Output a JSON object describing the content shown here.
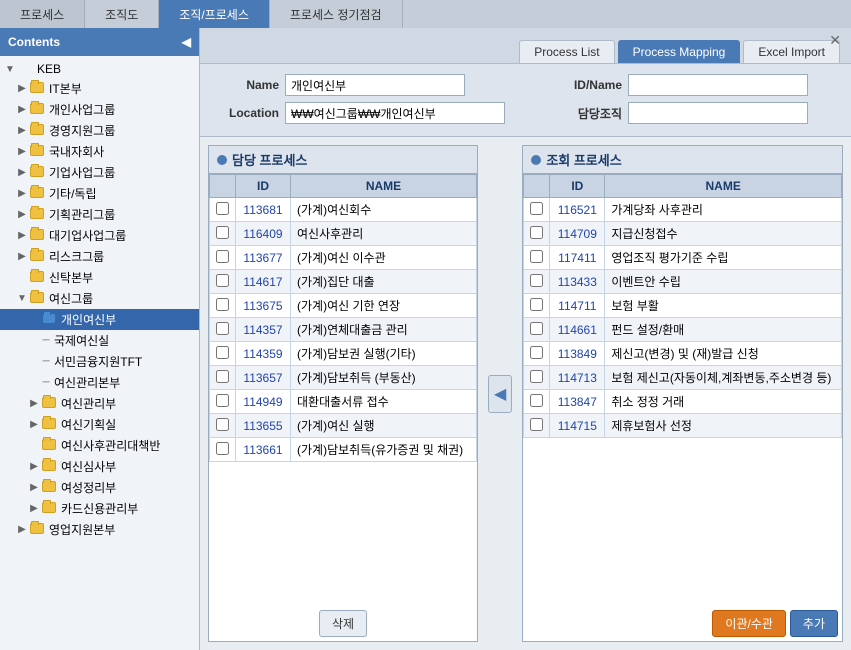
{
  "topNav": {
    "tabs": [
      {
        "id": "process",
        "label": "프로세스",
        "active": false
      },
      {
        "id": "orgchart",
        "label": "조직도",
        "active": false
      },
      {
        "id": "org-process",
        "label": "조직/프로세스",
        "active": true
      },
      {
        "id": "process-check",
        "label": "프로세스 정기점검",
        "active": false
      }
    ]
  },
  "subTabs": {
    "tabs": [
      {
        "id": "process-list",
        "label": "Process List",
        "active": false
      },
      {
        "id": "process-mapping",
        "label": "Process Mapping",
        "active": true
      },
      {
        "id": "excel-import",
        "label": "Excel Import",
        "active": false
      }
    ]
  },
  "sidebar": {
    "title": "Contents",
    "collapse_label": "◀",
    "tree": [
      {
        "id": "keb",
        "label": "KEB",
        "level": 0,
        "toggle": "▼",
        "type": "root"
      },
      {
        "id": "it",
        "label": "IT본부",
        "level": 1,
        "toggle": "▶",
        "type": "folder"
      },
      {
        "id": "personal-biz",
        "label": "개인사업그룹",
        "level": 1,
        "toggle": "▶",
        "type": "folder"
      },
      {
        "id": "mgmt-support",
        "label": "경영지원그룹",
        "level": 1,
        "toggle": "▶",
        "type": "folder"
      },
      {
        "id": "domestic-sub",
        "label": "국내자회사",
        "level": 1,
        "toggle": "▶",
        "type": "folder"
      },
      {
        "id": "corp-biz",
        "label": "기업사업그룹",
        "level": 1,
        "toggle": "▶",
        "type": "folder"
      },
      {
        "id": "other-indep",
        "label": "기타/독립",
        "level": 1,
        "toggle": "▶",
        "type": "folder"
      },
      {
        "id": "planning-mgmt",
        "label": "기획관리그룹",
        "level": 1,
        "toggle": "▶",
        "type": "folder"
      },
      {
        "id": "large-corp",
        "label": "대기업사업그룹",
        "level": 1,
        "toggle": "▶",
        "type": "folder"
      },
      {
        "id": "risk",
        "label": "리스크그룹",
        "level": 1,
        "toggle": "▶",
        "type": "folder"
      },
      {
        "id": "new-trust",
        "label": "신탁본부",
        "level": 1,
        "toggle": "",
        "type": "folder"
      },
      {
        "id": "women-credit",
        "label": "여신그룹",
        "level": 1,
        "toggle": "▼",
        "type": "folder"
      },
      {
        "id": "personal-credit",
        "label": "개인여신부",
        "level": 2,
        "toggle": "",
        "type": "folder",
        "selected": true
      },
      {
        "id": "intl-credit",
        "label": "국제여신실",
        "level": 3,
        "toggle": "",
        "type": "line"
      },
      {
        "id": "citizen-finance",
        "label": "서민금융지원TFT",
        "level": 3,
        "toggle": "",
        "type": "line"
      },
      {
        "id": "credit-mgmt",
        "label": "여신관리본부",
        "level": 3,
        "toggle": "",
        "type": "line"
      },
      {
        "id": "credit-mgmt-dept",
        "label": "여신관리부",
        "level": 2,
        "toggle": "▶",
        "type": "folder"
      },
      {
        "id": "credit-planning",
        "label": "여신기획실",
        "level": 2,
        "toggle": "▶",
        "type": "folder"
      },
      {
        "id": "credit-review",
        "label": "여신심사부",
        "level": 2,
        "toggle": "▶",
        "type": "folder"
      },
      {
        "id": "credit-mgmt2",
        "label": "여신사후관리대책반",
        "level": 2,
        "toggle": "",
        "type": "folder"
      },
      {
        "id": "credit-exam",
        "label": "여신심사부",
        "level": 2,
        "toggle": "▶",
        "type": "folder"
      },
      {
        "id": "credit-admin",
        "label": "여성정리부",
        "level": 2,
        "toggle": "▶",
        "type": "folder"
      },
      {
        "id": "card-credit",
        "label": "카드신용관리부",
        "level": 2,
        "toggle": "▶",
        "type": "folder"
      },
      {
        "id": "biz-support",
        "label": "영업지원본부",
        "level": 1,
        "toggle": "▶",
        "type": "folder"
      }
    ]
  },
  "form": {
    "name_label": "Name",
    "name_value": "개인여신부",
    "location_label": "Location",
    "location_value": "₩₩여신그룹₩₩개인여신부",
    "id_name_label": "ID/Name",
    "id_name_value": "",
    "resp_org_label": "담당조직",
    "resp_org_value": ""
  },
  "leftPanel": {
    "title": "담당 프로세스",
    "columns": [
      "",
      "ID",
      "NAME"
    ],
    "rows": [
      {
        "id": "113681",
        "name": "(가계)여신회수"
      },
      {
        "id": "116409",
        "name": "여신사후관리"
      },
      {
        "id": "113677",
        "name": "(가계)여신 이수관"
      },
      {
        "id": "114617",
        "name": "(가계)집단 대출"
      },
      {
        "id": "113675",
        "name": "(가계)여신 기한 연장"
      },
      {
        "id": "114357",
        "name": "(가계)연체대출금 관리"
      },
      {
        "id": "114359",
        "name": "(가계)담보권 실행(기타)"
      },
      {
        "id": "113657",
        "name": "(가계)담보취득 (부동산)"
      },
      {
        "id": "114949",
        "name": "대환대출서류 접수"
      },
      {
        "id": "113655",
        "name": "(가계)여신 실행"
      },
      {
        "id": "113661",
        "name": "(가계)담보취득(유가증권 및 채권)"
      }
    ],
    "delete_btn": "삭제"
  },
  "rightPanel": {
    "title": "조회 프로세스",
    "columns": [
      "",
      "ID",
      "NAME"
    ],
    "rows": [
      {
        "id": "116521",
        "name": "가계당좌 사후관리"
      },
      {
        "id": "114709",
        "name": "지급신청접수"
      },
      {
        "id": "117411",
        "name": "영업조직 평가기준 수립"
      },
      {
        "id": "113433",
        "name": "이벤트안 수립"
      },
      {
        "id": "114711",
        "name": "보험 부활"
      },
      {
        "id": "114661",
        "name": "펀드 설정/환매"
      },
      {
        "id": "113849",
        "name": "제신고(변경) 및 (재)발급 신청"
      },
      {
        "id": "114713",
        "name": "보험 제신고(자동이체,계좌변동,주소변경 등)"
      },
      {
        "id": "113847",
        "name": "취소 정정 거래"
      },
      {
        "id": "114715",
        "name": "제휴보험사 선정"
      }
    ],
    "transfer_btn": "이관/수관",
    "add_btn": "추가"
  }
}
